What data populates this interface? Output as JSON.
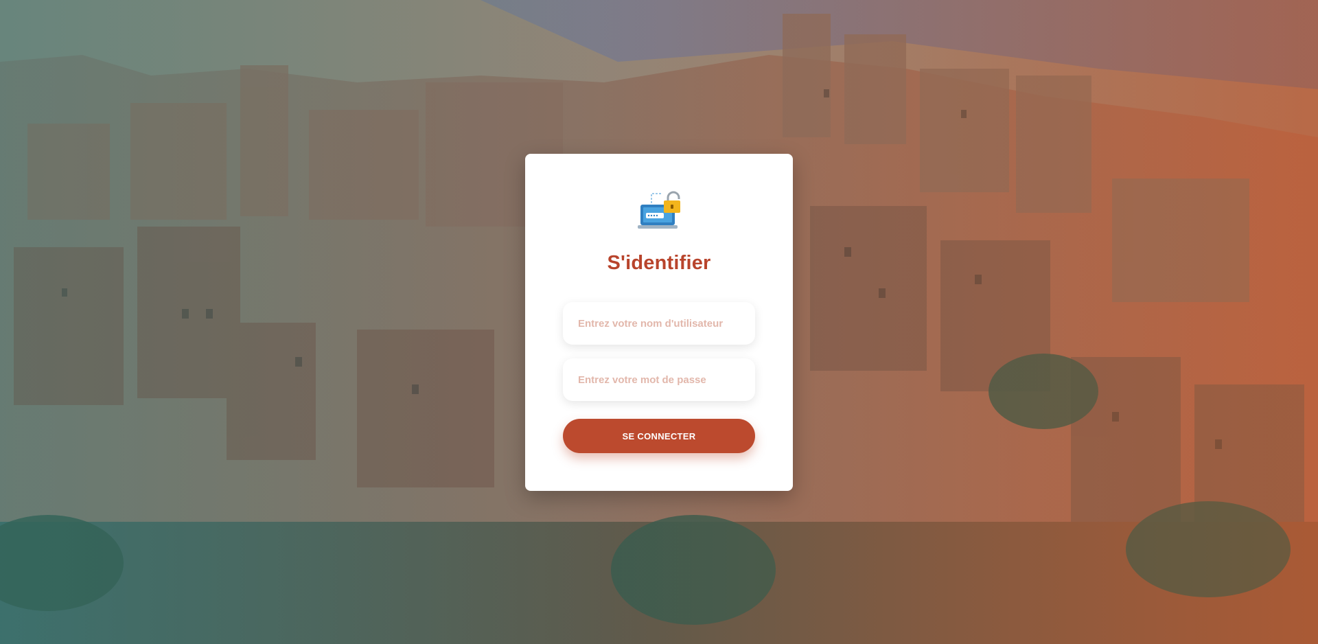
{
  "background": {
    "description_icon": "moroccan-kasbah-photo",
    "overlay_colors": [
      "#3c7878",
      "#c85a28"
    ]
  },
  "login": {
    "icon": "laptop-lock-icon",
    "title": "S'identifier",
    "username_placeholder": "Entrez votre nom d'utilisateur",
    "password_placeholder": "Entrez votre mot de passe",
    "submit_label": "SE CONNECTER",
    "accent_color": "#bc4a2e"
  }
}
